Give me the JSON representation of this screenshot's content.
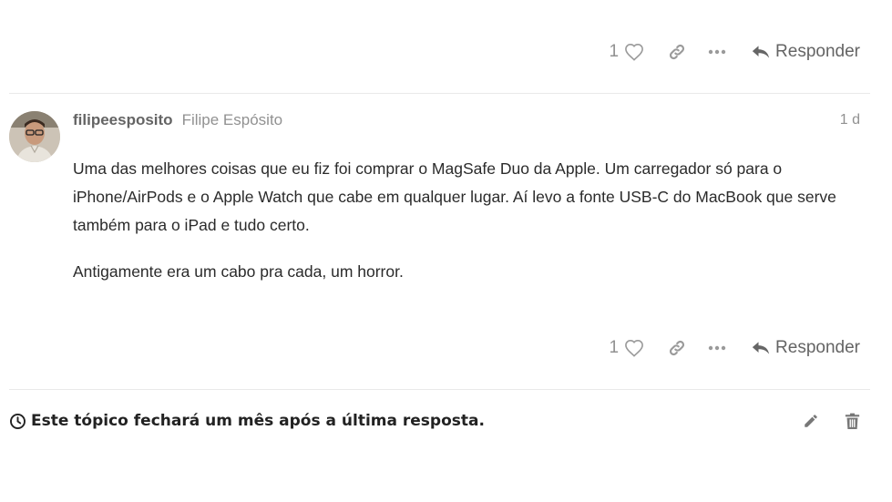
{
  "top_actions": {
    "like_count": "1",
    "reply_label": "Responder"
  },
  "post": {
    "username": "filipeesposito",
    "full_name": "Filipe Espósito",
    "date": "1 d",
    "paragraphs": [
      "Uma das melhores coisas que eu fiz foi comprar o MagSafe Duo da Apple. Um carregador só para o iPhone/AirPods e o Apple Watch que cabe em qualquer lugar. Aí levo a fonte USB-C do MacBook que serve também para o iPad e tudo certo.",
      "Antigamente era um cabo pra cada, um horror."
    ],
    "like_count": "1",
    "reply_label": "Responder"
  },
  "topic_timer": {
    "message": "Este tópico fechará um mês após a última resposta."
  },
  "icons": {
    "heart": "heart-icon",
    "link": "link-icon",
    "more": "ellipsis-icon",
    "reply": "reply-arrow-icon",
    "clock": "clock-icon",
    "edit": "pencil-icon",
    "delete": "trash-icon"
  },
  "colors": {
    "muted": "#919191",
    "text": "#222222",
    "divider": "#e9e9e9"
  }
}
